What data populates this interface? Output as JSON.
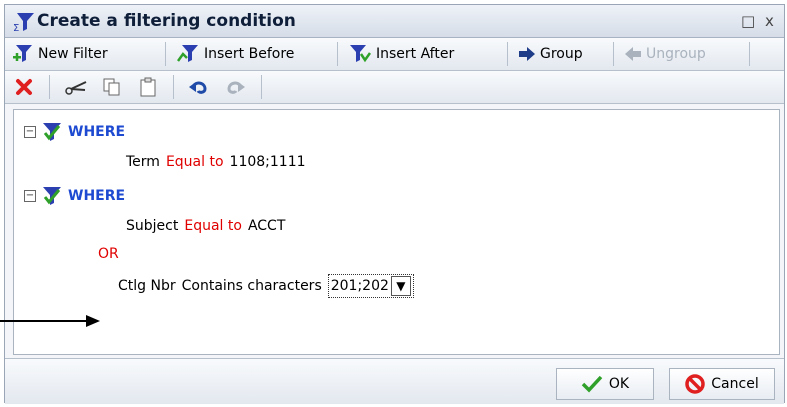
{
  "window": {
    "title": "Create a filtering condition",
    "restore_glyph": "□",
    "close_glyph": "x"
  },
  "toolbar1": {
    "new_filter": "New Filter",
    "insert_before": "Insert Before",
    "insert_after": "Insert After",
    "group": "Group",
    "ungroup": "Ungroup"
  },
  "toolbar2": {
    "icons": [
      "delete-icon",
      "cut-icon",
      "copy-icon",
      "paste-icon",
      "undo-icon",
      "redo-icon"
    ]
  },
  "conditions": {
    "where1": {
      "keyword": "WHERE",
      "field": "Term",
      "operator": "Equal to",
      "value": "1108;1111"
    },
    "where2": {
      "keyword": "WHERE",
      "field": "Subject",
      "operator": "Equal to",
      "value": "ACCT"
    },
    "or_keyword": "OR",
    "ctlg": {
      "field": "Ctlg Nbr",
      "operator": "Contains characters",
      "value": "201;202"
    }
  },
  "footer": {
    "ok": "OK",
    "cancel": "Cancel"
  },
  "colors": {
    "where_blue": "#1d4ad1",
    "operator_red": "#e00000",
    "funnel_blue": "#2b3fb0",
    "check_green": "#2fa12a"
  }
}
